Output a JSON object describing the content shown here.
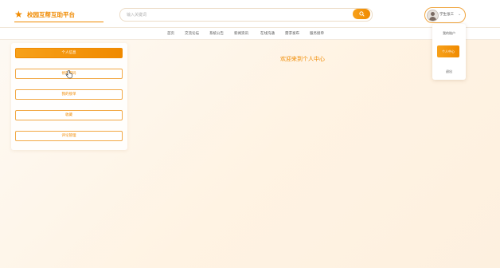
{
  "header": {
    "logo_text": "校园互帮互助平台",
    "search_placeholder": "输入关键词",
    "user_name": "学生张三",
    "caret": "⌄"
  },
  "nav": {
    "items": [
      "首页",
      "交流论坛",
      "系统公告",
      "新闻资讯",
      "在线沟通",
      "需求发布",
      "服务接单"
    ]
  },
  "sidebar": {
    "items": [
      {
        "label": "个人信息",
        "active": true
      },
      {
        "label": "修改密码",
        "active": false
      },
      {
        "label": "我的接单",
        "active": false
      },
      {
        "label": "收藏",
        "active": false
      },
      {
        "label": "评论管理",
        "active": false
      }
    ]
  },
  "main": {
    "welcome": "欢迎来到个人中心"
  },
  "user_menu": {
    "items": [
      "我的账户",
      "个人中心",
      "退出"
    ]
  },
  "colors": {
    "accent": "#f08a00",
    "accent_light": "#f7a11a"
  }
}
